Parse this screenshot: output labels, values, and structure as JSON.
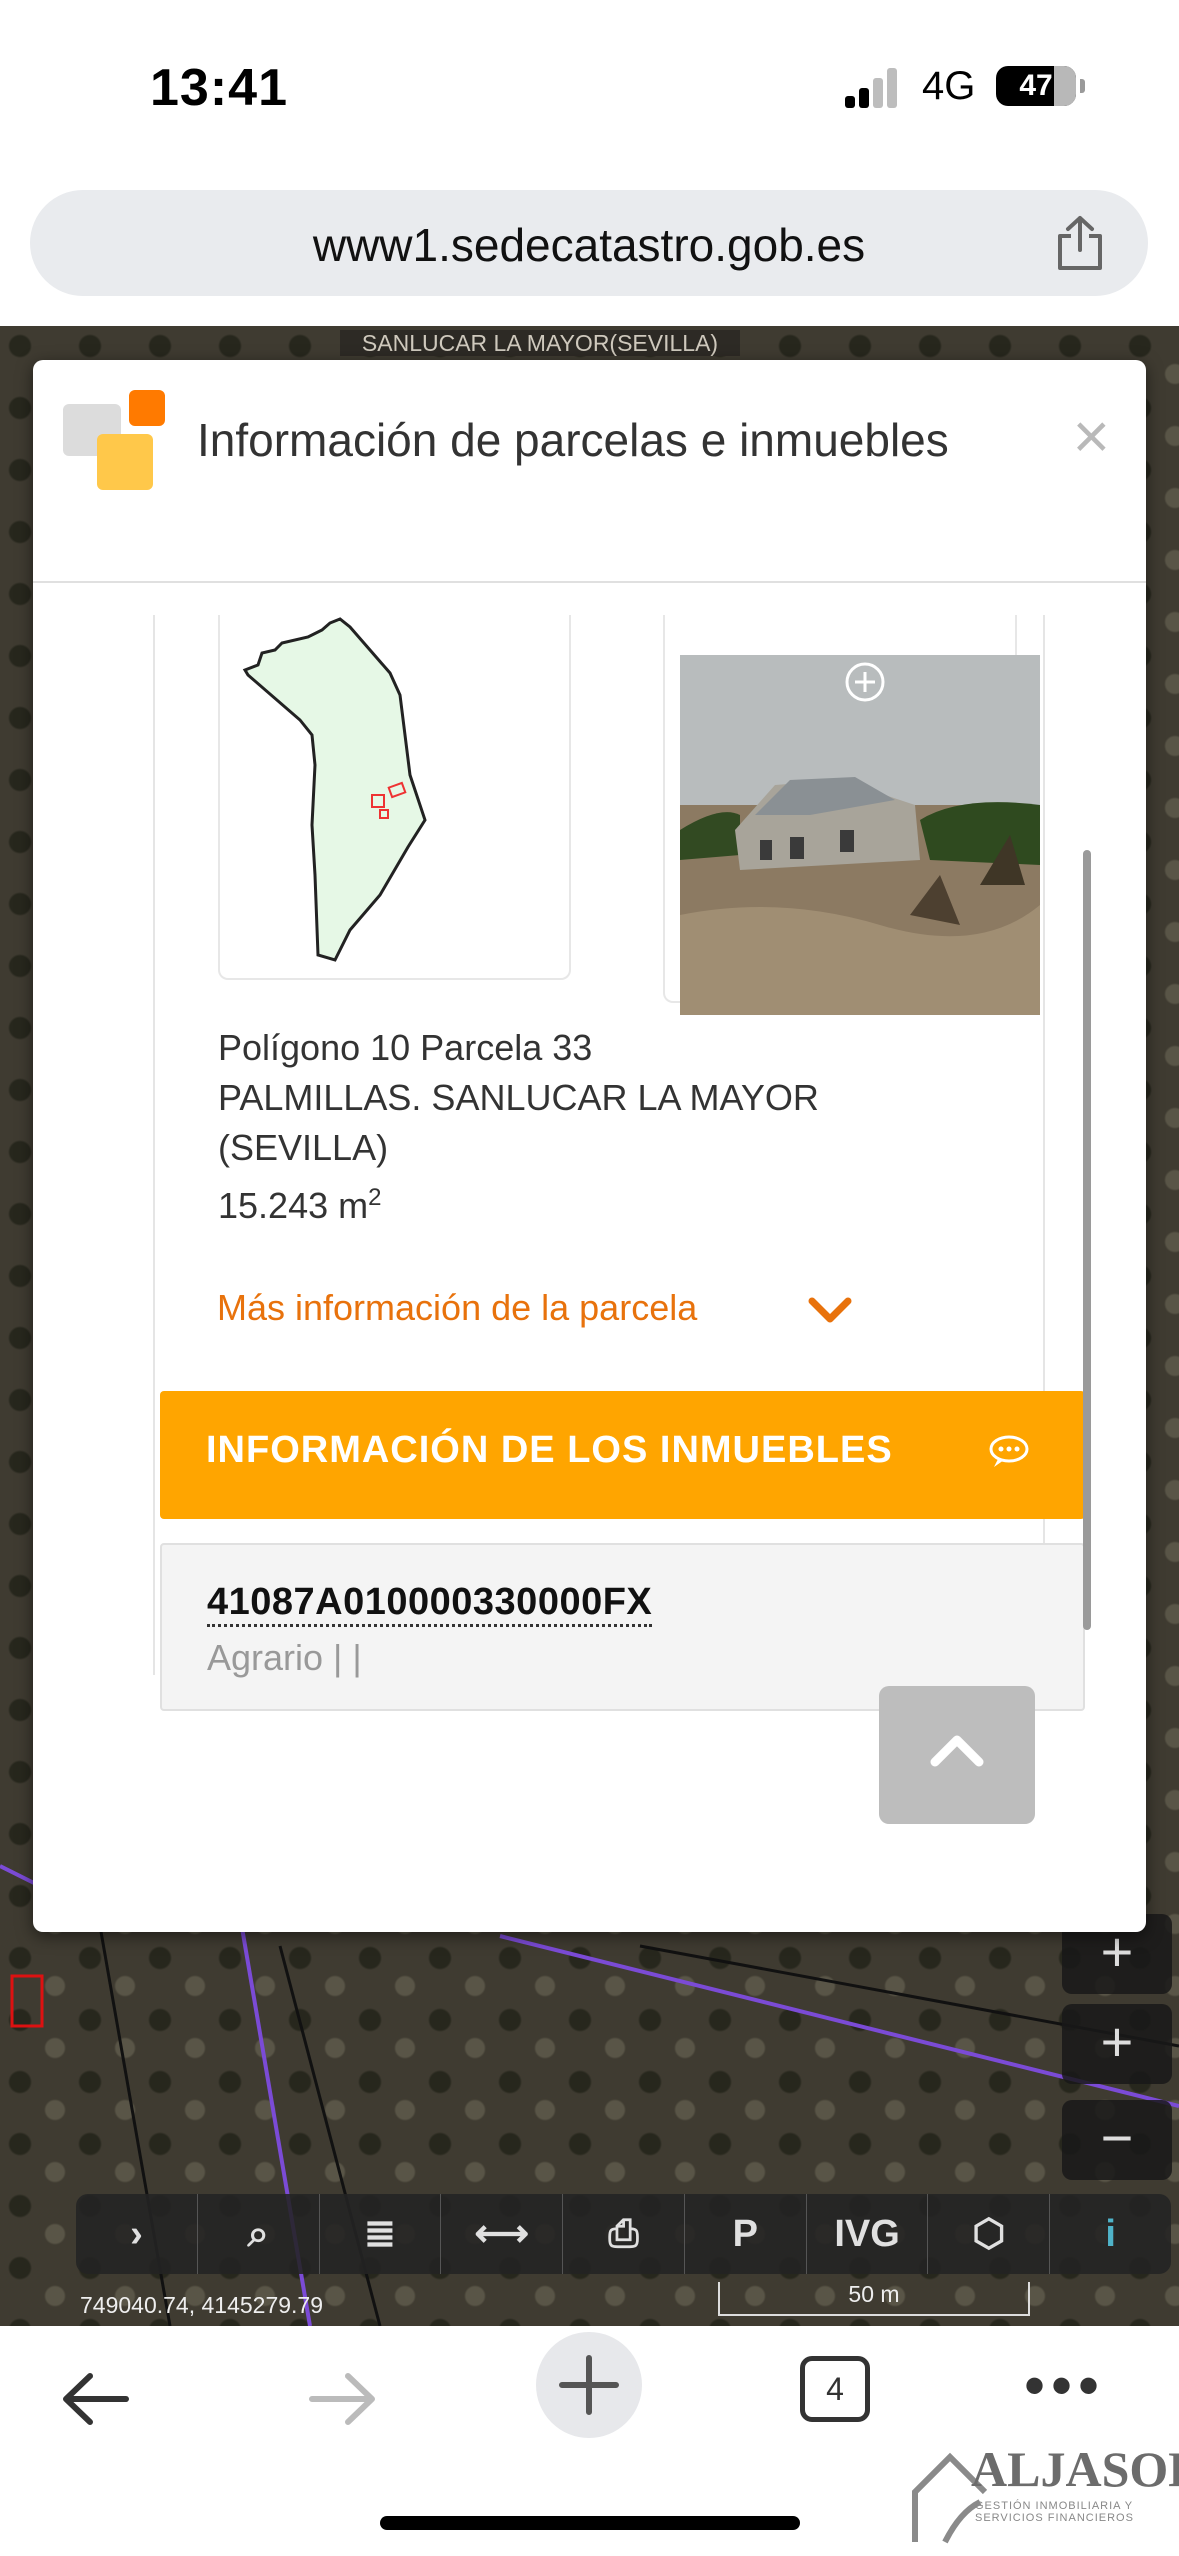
{
  "status_bar": {
    "time": "13:41",
    "network": "4G",
    "battery": "47"
  },
  "browser": {
    "url": "www1.sedecatastro.gob.es",
    "tab_count": "4",
    "more_label": "•••"
  },
  "map": {
    "municipality": "SANLUCAR LA MAYOR(SEVILLA)",
    "coordinates": "749040.74, 4145279.79",
    "scale": "50 m",
    "toolbar": [
      "›",
      "⌕",
      "≣",
      "⟷",
      "⎙",
      "P",
      "IVG",
      "⬡",
      "i"
    ],
    "zoom_in": "+",
    "zoom_out": "−"
  },
  "modal": {
    "title": "Información de parcelas e inmuebles",
    "close_label": "×",
    "parcel": {
      "line1": "Polígono 10 Parcela 33",
      "line2": "PALMILLAS. SANLUCAR LA MAYOR",
      "line3": "(SEVILLA)",
      "area": "15.243 m",
      "area_sup": "2"
    },
    "more_info": "Más información de la parcela",
    "buildings_header": "INFORMACIÓN DE LOS INMUEBLES",
    "property": {
      "ref": "41087A010000330000FX",
      "use": "Agrario | |"
    }
  },
  "watermark": {
    "brand": "ALJASOL",
    "tagline": "GESTIÓN INMOBILIARIA Y SERVICIOS FINANCIEROS"
  },
  "colors": {
    "accent_orange": "#ffa500",
    "link_orange": "#e8720c",
    "parcel_fill": "#e6f8e6"
  }
}
